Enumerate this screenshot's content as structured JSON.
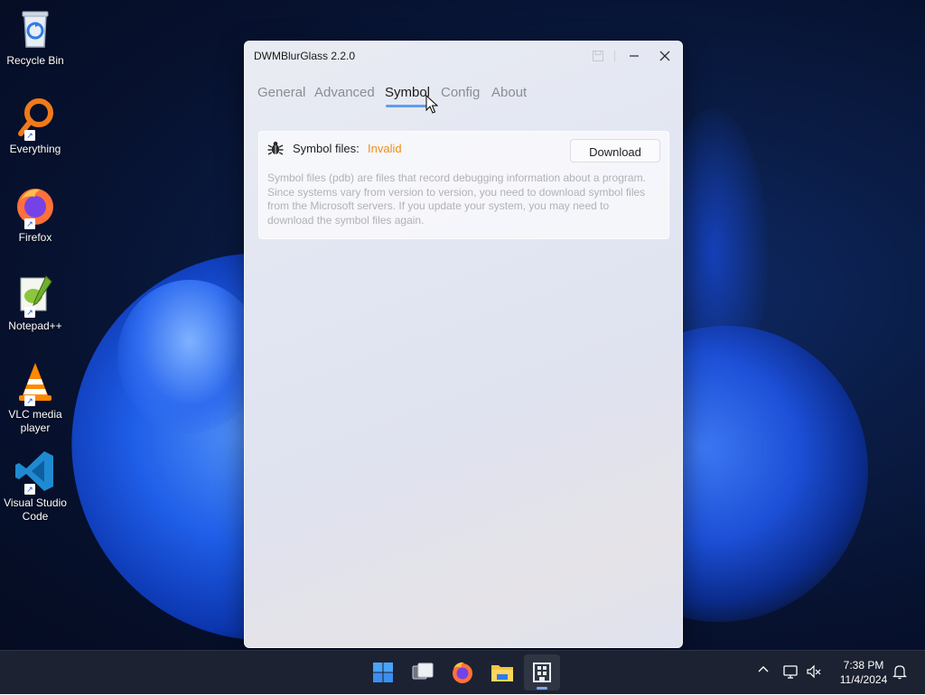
{
  "desktop": {
    "icons": [
      {
        "label": "Recycle Bin",
        "icon": "recycle-bin-icon"
      },
      {
        "label": "Everything",
        "icon": "everything-search-icon"
      },
      {
        "label": "Firefox",
        "icon": "firefox-icon"
      },
      {
        "label": "Notepad++",
        "icon": "notepad-plus-plus-icon"
      },
      {
        "label": "VLC media player",
        "icon": "vlc-icon"
      },
      {
        "label": "Visual Studio Code",
        "icon": "vscode-icon"
      }
    ]
  },
  "window": {
    "title": "DWMBlurGlass 2.2.0",
    "tabs": [
      {
        "label": "General",
        "active": false
      },
      {
        "label": "Advanced",
        "active": false
      },
      {
        "label": "Symbol",
        "active": true
      },
      {
        "label": "Config",
        "active": false
      },
      {
        "label": "About",
        "active": false
      }
    ],
    "symbol_card": {
      "label": "Symbol files:",
      "status": "Invalid",
      "status_color": "#f08c1c",
      "button": "Download",
      "description": "Symbol files (pdb) are files that record debugging information about a program. Since systems vary from version to version, you need to download symbol files from the Microsoft servers. If you update your system, you may need to download the symbol files again."
    }
  },
  "taskbar": {
    "apps": [
      "start-icon",
      "task-view-icon",
      "firefox-icon",
      "file-explorer-icon",
      "dwmblurglass-icon"
    ],
    "active_app": "dwmblurglass-icon",
    "tray": [
      "chevron-up-icon",
      "network-icon",
      "volume-muted-icon",
      "notification-bell-icon"
    ],
    "time": "7:38 PM",
    "date": "11/4/2024"
  },
  "colors": {
    "accent": "#5d9ef0",
    "taskbar": "#1c2231"
  }
}
